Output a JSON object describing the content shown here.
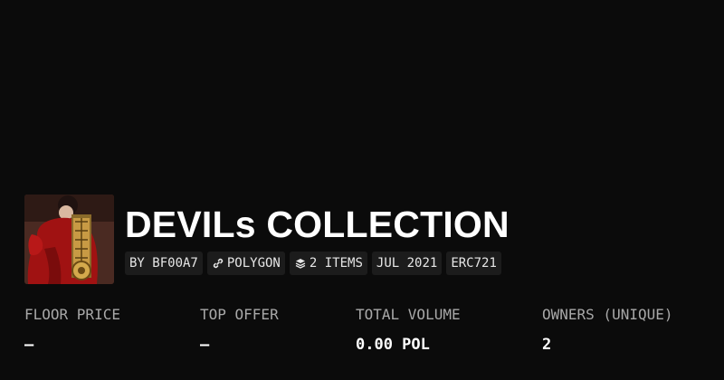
{
  "collection": {
    "title": "DEVILs COLLECTION",
    "avatar_alt": "collection-avatar"
  },
  "chips": {
    "creator": "BY BF00A7",
    "chain": "POLYGON",
    "chain_icon": "link-icon",
    "items": "2 ITEMS",
    "items_icon": "layers-icon",
    "date": "JUL 2021",
    "standard": "ERC721"
  },
  "stats": {
    "floor_price": {
      "label": "FLOOR PRICE",
      "value": "—"
    },
    "top_offer": {
      "label": "TOP OFFER",
      "value": "—"
    },
    "total_volume": {
      "label": "TOTAL VOLUME",
      "value": "0.00 POL"
    },
    "owners": {
      "label": "OWNERS (UNIQUE)",
      "value": "2"
    }
  },
  "colors": {
    "background": "#0b0b0b",
    "chip_background": "#1c1c1c",
    "label": "#a8a8a8",
    "text": "#ffffff"
  }
}
